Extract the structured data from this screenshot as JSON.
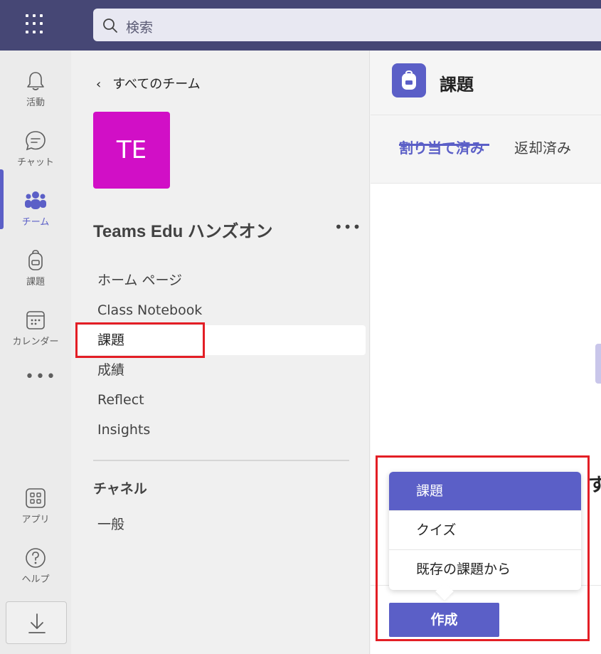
{
  "search": {
    "placeholder": "検索"
  },
  "rail": {
    "items": [
      {
        "label": "活動",
        "icon": "bell-icon"
      },
      {
        "label": "チャット",
        "icon": "chat-icon"
      },
      {
        "label": "チーム",
        "icon": "teams-icon",
        "active": true
      },
      {
        "label": "課題",
        "icon": "backpack-icon"
      },
      {
        "label": "カレンダー",
        "icon": "calendar-icon"
      }
    ],
    "more": "•••",
    "bottom": [
      {
        "label": "アプリ",
        "icon": "apps-icon"
      },
      {
        "label": "ヘルプ",
        "icon": "help-icon"
      }
    ]
  },
  "team": {
    "back_label": "すべてのチーム",
    "avatar_initials": "TE",
    "avatar_color": "#d10fc6",
    "name": "Teams Edu ハンズオン",
    "more": "•••",
    "nav": [
      "ホーム ページ",
      "Class Notebook",
      "課題",
      "成績",
      "Reflect",
      "Insights"
    ],
    "selected_nav": "課題",
    "channels_heading": "チャネル",
    "channels": [
      "一般"
    ]
  },
  "main": {
    "title": "課題",
    "tabs": [
      "割り当て済み",
      "返却済み"
    ],
    "active_tab": "割り当て済み",
    "edge_text": "す"
  },
  "menu": {
    "items": [
      "課題",
      "クイズ",
      "既存の課題から"
    ],
    "highlighted": "課題"
  },
  "create_button": "作成",
  "colors": {
    "accent": "#5b5fc7",
    "topbar": "#464775",
    "highlight_box": "#e31e25"
  }
}
